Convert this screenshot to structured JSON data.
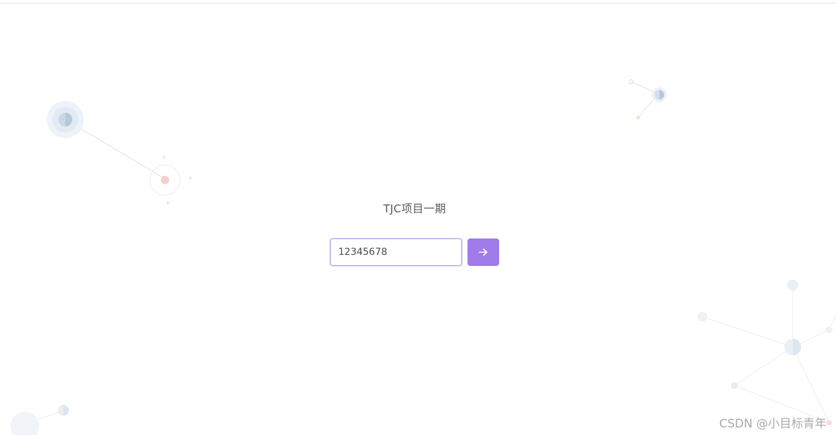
{
  "page": {
    "title": "TJC项目一期"
  },
  "login": {
    "code_value": "12345678",
    "submit_icon": "arrow-right-icon"
  },
  "watermark": {
    "text": "CSDN @小目标青年"
  },
  "colors": {
    "accent": "#9f7cea",
    "input_border": "#a99be4",
    "title_text": "#555a5f",
    "watermark_text": "#a9a9a9",
    "background": "#ffffff"
  }
}
